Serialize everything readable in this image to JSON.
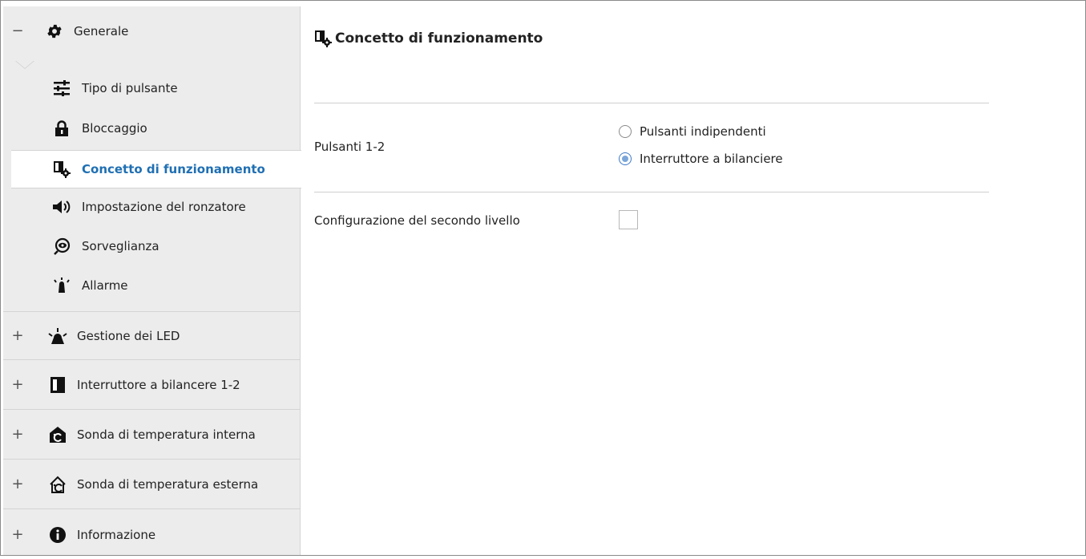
{
  "sidebar": {
    "generale": {
      "toggle": "−",
      "label": "Generale",
      "icon": "gear-icon"
    },
    "sub_items": [
      {
        "label": "Tipo di pulsante",
        "icon": "sliders-icon"
      },
      {
        "label": "Bloccaggio",
        "icon": "lock-icon"
      },
      {
        "label": "Concetto di funzionamento",
        "icon": "operation-concept-icon",
        "active": true
      },
      {
        "label": "Impostazione del ronzatore",
        "icon": "speaker-icon"
      },
      {
        "label": "Sorveglianza",
        "icon": "surveillance-icon"
      },
      {
        "label": "Allarme",
        "icon": "alarm-icon"
      }
    ],
    "groups": [
      {
        "toggle": "+",
        "label": "Gestione dei LED",
        "icon": "led-icon"
      },
      {
        "toggle": "+",
        "label": "Interruttore a bilancere 1-2",
        "icon": "rocker-switch-icon"
      },
      {
        "toggle": "+",
        "label": "Sonda di temperatura interna",
        "icon": "indoor-temperature-icon"
      },
      {
        "toggle": "+",
        "label": "Sonda di temperatura esterna",
        "icon": "outdoor-temperature-icon"
      },
      {
        "toggle": "+",
        "label": "Informazione",
        "icon": "info-icon"
      }
    ]
  },
  "main": {
    "title": "Concetto di funzionamento",
    "title_icon": "operation-concept-icon",
    "pulsanti": {
      "label": "Pulsanti 1-2",
      "options": [
        {
          "label": "Pulsanti indipendenti",
          "checked": false
        },
        {
          "label": "Interruttore a bilanciere",
          "checked": true
        }
      ]
    },
    "secondo_livello": {
      "label": "Configurazione del secondo livello",
      "checked": false
    }
  },
  "colors": {
    "active_text": "#1f6fb3",
    "sidebar_bg": "#ececec",
    "radio_accent": "#3d78c7"
  }
}
